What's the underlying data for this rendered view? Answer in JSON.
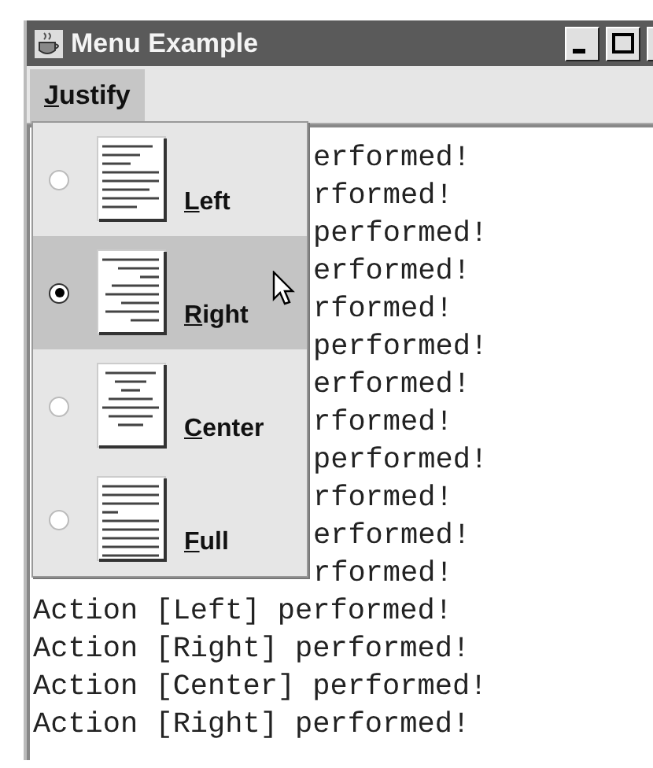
{
  "window": {
    "title": "Menu Example"
  },
  "menubar": [
    {
      "label": "Justify",
      "selected": true
    }
  ],
  "menu": [
    {
      "kind": "left",
      "label": "Left",
      "selected": false
    },
    {
      "kind": "right",
      "label": "Right",
      "selected": true
    },
    {
      "kind": "center",
      "label": "Center",
      "selected": false
    },
    {
      "kind": "full",
      "label": "Full",
      "selected": false
    }
  ],
  "output_lines": [
    {
      "text": "erformed!",
      "covered": true
    },
    {
      "text": "rformed!",
      "covered": true
    },
    {
      "text": "performed!",
      "covered": true
    },
    {
      "text": "erformed!",
      "covered": true
    },
    {
      "text": "rformed!",
      "covered": true
    },
    {
      "text": "performed!",
      "covered": true
    },
    {
      "text": "erformed!",
      "covered": true
    },
    {
      "text": "rformed!",
      "covered": true
    },
    {
      "text": "performed!",
      "covered": true
    },
    {
      "text": "rformed!",
      "covered": true
    },
    {
      "text": "erformed!",
      "covered": true
    },
    {
      "text": "rformed!",
      "covered": true
    },
    {
      "text": "Action [Left] performed!",
      "covered": false
    },
    {
      "text": "Action [Right] performed!",
      "covered": false
    },
    {
      "text": "Action [Center] performed!",
      "covered": false
    },
    {
      "text": "Action [Right] performed!",
      "covered": false
    }
  ]
}
